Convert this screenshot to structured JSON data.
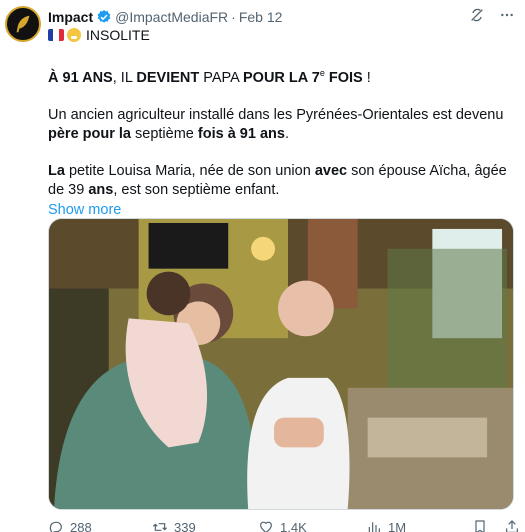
{
  "account": {
    "name": "Impact",
    "handle": "@ImpactMediaFR",
    "separator": "·",
    "date": "Feb 12"
  },
  "tag": {
    "label": "INSOLITE"
  },
  "post": {
    "headline": {
      "p1": "À 91 ANS",
      "p2": ", IL ",
      "p3": "DEVIENT",
      "p4": " PAPA ",
      "p5": "POUR LA 7",
      "sup": "e",
      "p6": " FOIS",
      "p7": " !"
    },
    "para2": {
      "p1": "Un ancien agriculteur installé dans les Pyrénées-Orientales est devenu ",
      "p2": "père pour la",
      "p3": " septième ",
      "p4": "fois à 91 ans",
      "p5": "."
    },
    "para3": {
      "p1": "La",
      "p2": " petite Louisa Maria, née de son union ",
      "p3": "avec",
      "p4": " son épouse Aïcha, âgée de 39 ",
      "p5": "ans",
      "p6": ", est son septième enfant."
    },
    "show_more": "Show more"
  },
  "metrics": {
    "replies": "288",
    "reposts": "339",
    "likes": "1.4K",
    "views": "1M"
  },
  "colors": {
    "accent": "#1d9bf0",
    "muted": "#536471",
    "text": "#0f1419",
    "avatar_ring": "#d4a72c"
  },
  "icons": [
    "verified-badge-icon",
    "grok-icon",
    "more-icon",
    "france-flag-icon",
    "baby-emoji-icon",
    "reply-icon",
    "repost-icon",
    "like-icon",
    "views-icon",
    "bookmark-icon",
    "share-icon"
  ]
}
